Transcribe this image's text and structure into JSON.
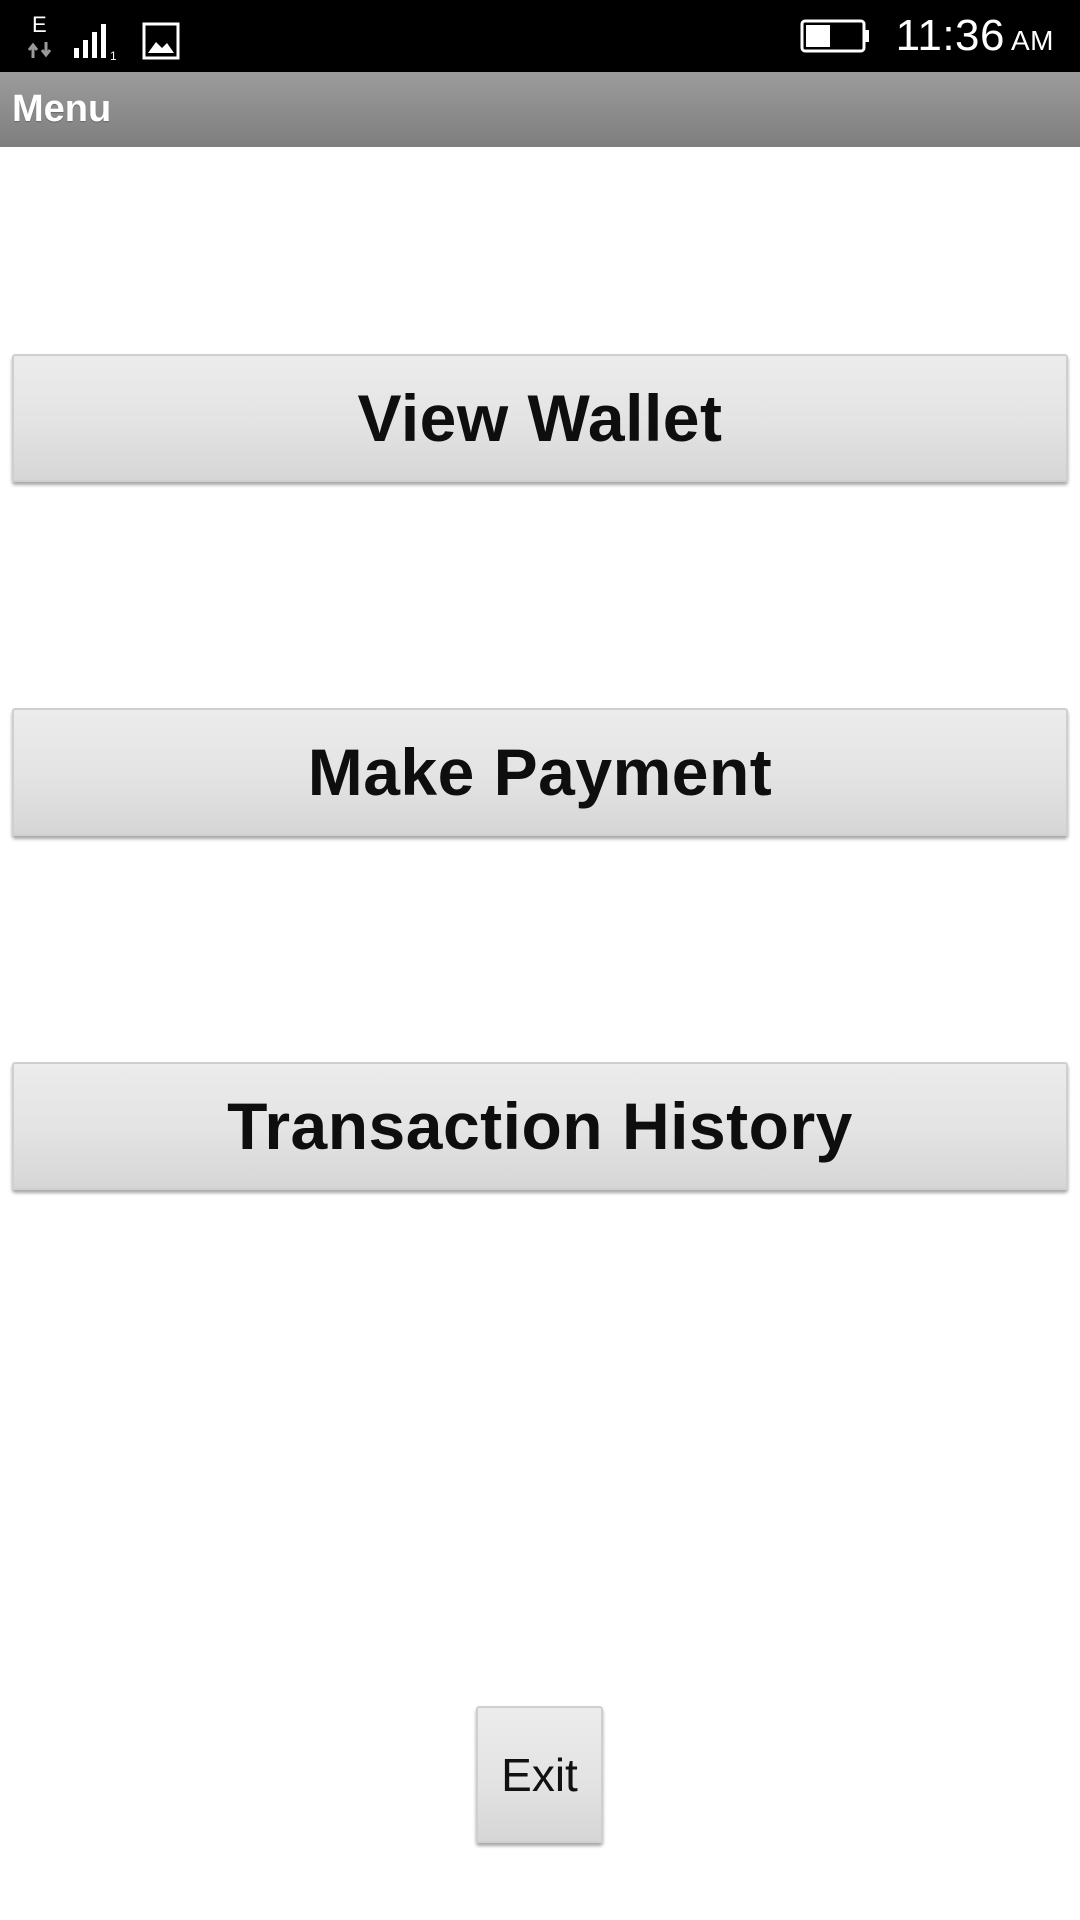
{
  "status_bar": {
    "network_type": "E",
    "signal_sim": "1",
    "time": "11:36",
    "ampm": "AM",
    "icons": [
      "network-type-icon",
      "signal-icon",
      "gallery-icon",
      "battery-icon"
    ],
    "battery_level": 0.45
  },
  "title_bar": {
    "title": "Menu"
  },
  "menu": {
    "view_wallet": "View Wallet",
    "make_payment": "Make Payment",
    "transaction_history": "Transaction History",
    "exit": "Exit"
  },
  "colors": {
    "status_bar_bg": "#000000",
    "title_bar_bg": "#8e8e8e",
    "button_bg": "#e3e3e3",
    "button_text": "#0e0e0e"
  }
}
